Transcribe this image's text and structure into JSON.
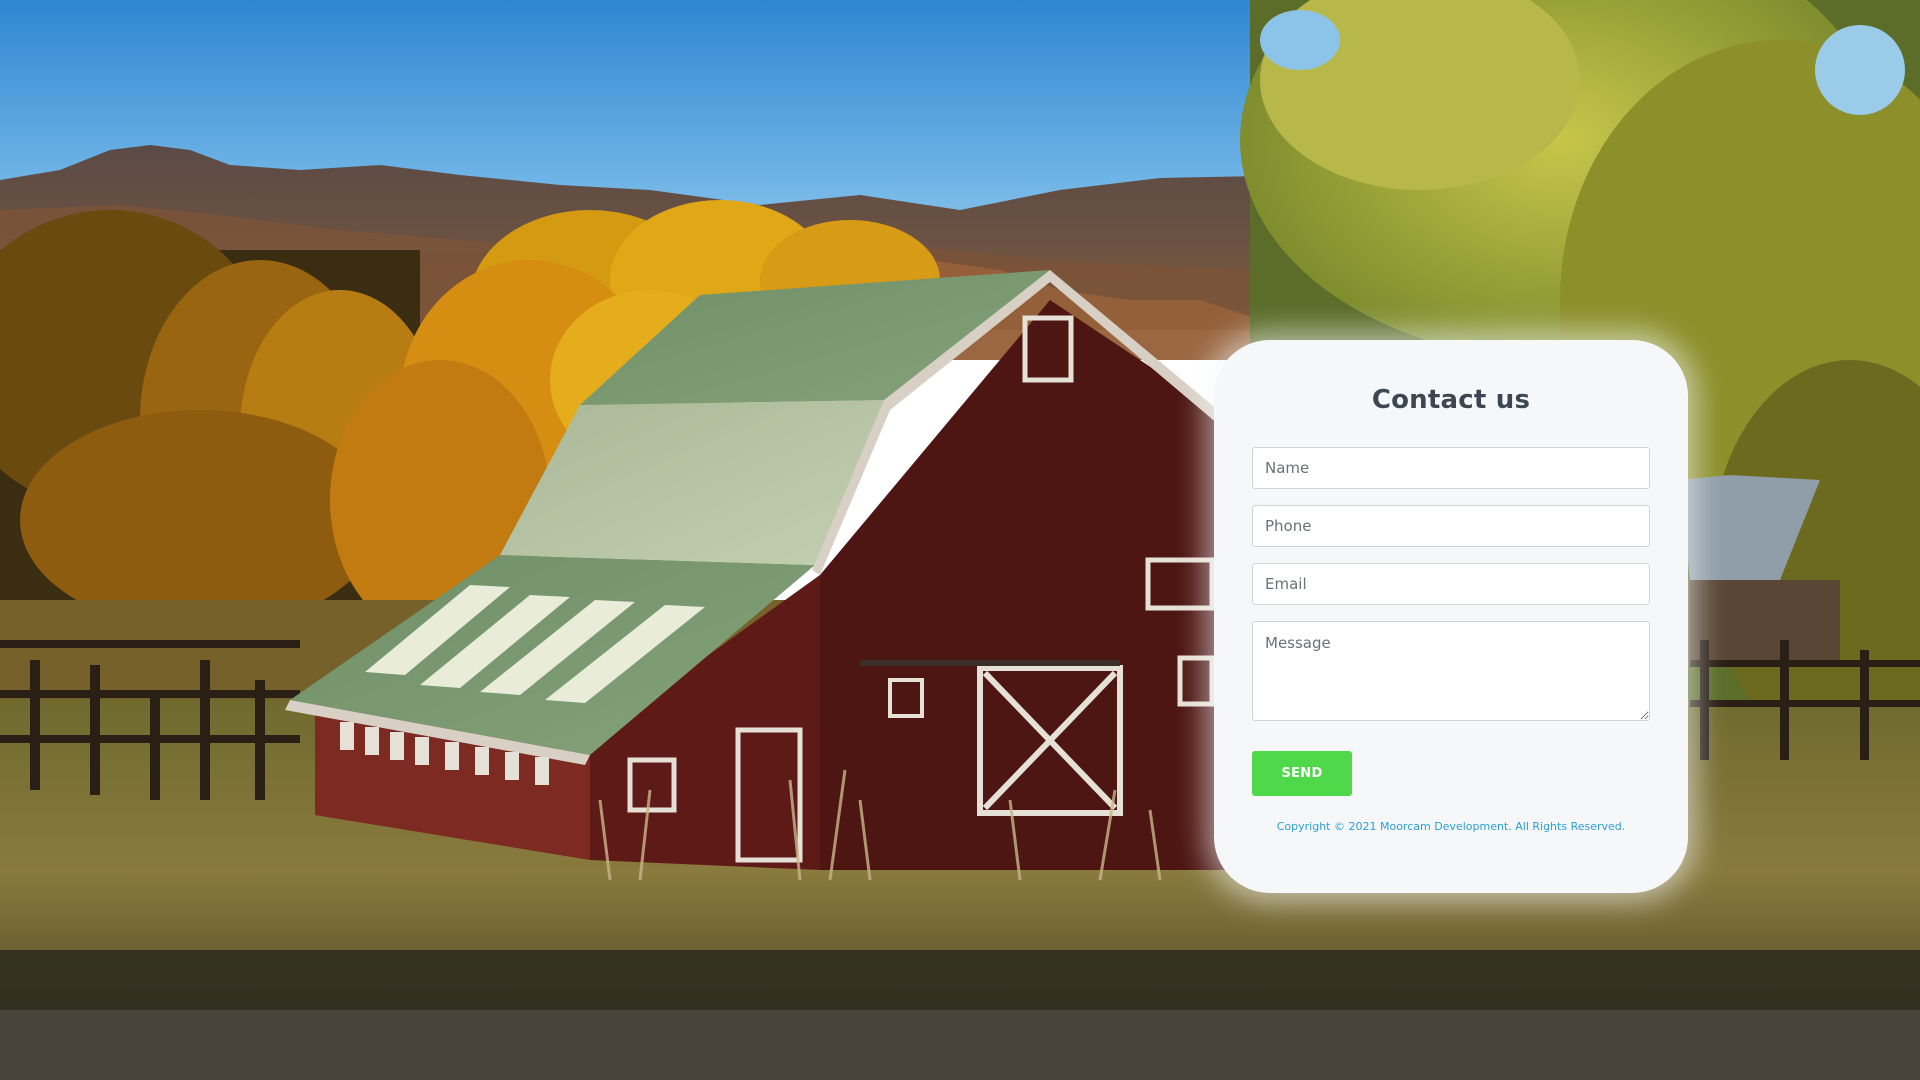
{
  "contact": {
    "title": "Contact us",
    "name_placeholder": "Name",
    "phone_placeholder": "Phone",
    "email_placeholder": "Email",
    "message_placeholder": "Message",
    "send_label": "SEND",
    "copyright": "Copyright © 2021 Moorcam Development. All Rights Reserved."
  },
  "colors": {
    "button": "#4fd94a",
    "copyright": "#2aa0d6",
    "card": "#f6f7f9",
    "title": "#3d4752"
  },
  "background": {
    "image": "barn-landscape-photo"
  }
}
